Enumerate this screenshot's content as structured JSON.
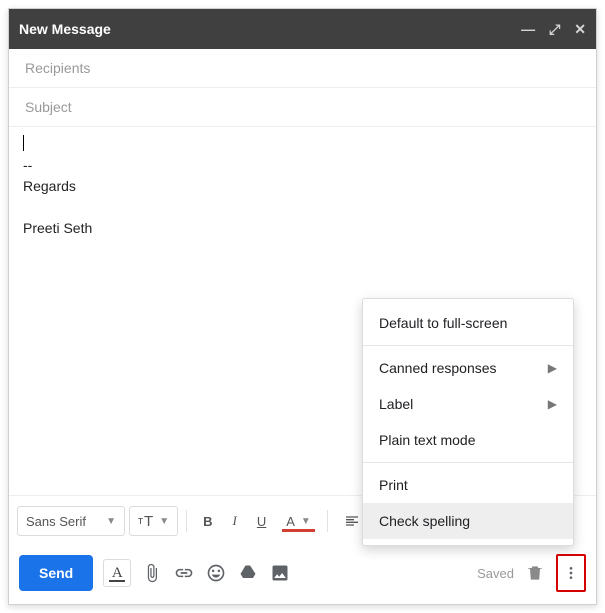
{
  "header": {
    "title": "New Message"
  },
  "fields": {
    "recipients_placeholder": "Recipients",
    "subject_placeholder": "Subject"
  },
  "body": {
    "sig_dashes": "--",
    "sig_line1": "Regards",
    "sig_line2": "Preeti Seth"
  },
  "format": {
    "font": "Sans Serif",
    "size_icon": "tT",
    "bold": "B",
    "italic": "I",
    "underline": "U",
    "color": "A"
  },
  "bottom": {
    "send": "Send",
    "saved": "Saved"
  },
  "menu": {
    "fullscreen": "Default to full-screen",
    "canned": "Canned responses",
    "label": "Label",
    "plain": "Plain text mode",
    "print": "Print",
    "spell": "Check spelling"
  }
}
